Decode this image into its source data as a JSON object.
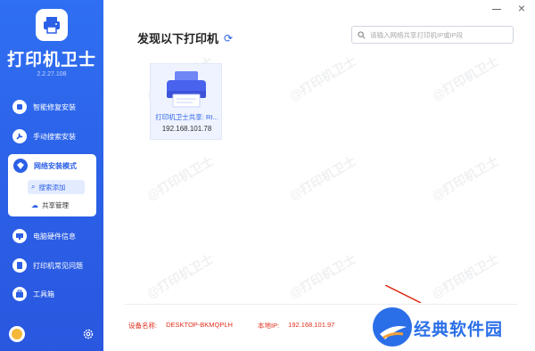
{
  "app": {
    "title": "打印机卫士",
    "version": "2.2.27.108"
  },
  "sidebar": {
    "items": [
      {
        "label": "智能修复安装",
        "icon": "repair-icon"
      },
      {
        "label": "手动搜索安装",
        "icon": "wrench-icon"
      },
      {
        "label": "网络安装模式",
        "icon": "network-icon"
      },
      {
        "label": "电脑硬件信息",
        "icon": "monitor-icon"
      },
      {
        "label": "打印机常见问题",
        "icon": "question-icon"
      },
      {
        "label": "工具箱",
        "icon": "toolbox-icon"
      }
    ],
    "sub_items": [
      {
        "label": "搜索添加",
        "icon": "search-icon",
        "active": true
      },
      {
        "label": "共享管理",
        "icon": "cloud-icon",
        "active": false
      }
    ]
  },
  "main": {
    "section_title": "发现以下打印机",
    "search_placeholder": "请输入网络共享打印机IP或IP段",
    "printers": [
      {
        "name": "打印机卫士共享: RI...",
        "ip": "192.168.101.78"
      }
    ]
  },
  "watermark": "@打印机卫士",
  "footer": {
    "device_label": "设备名称:",
    "device_value": "DESKTOP-BKMQPLH",
    "ip_label": "本地IP:",
    "ip_value": "192.168.101.97"
  },
  "brand_badge": "经典软件园",
  "colors": {
    "accent": "#2b5fe6",
    "footer_text": "#e0301e"
  }
}
